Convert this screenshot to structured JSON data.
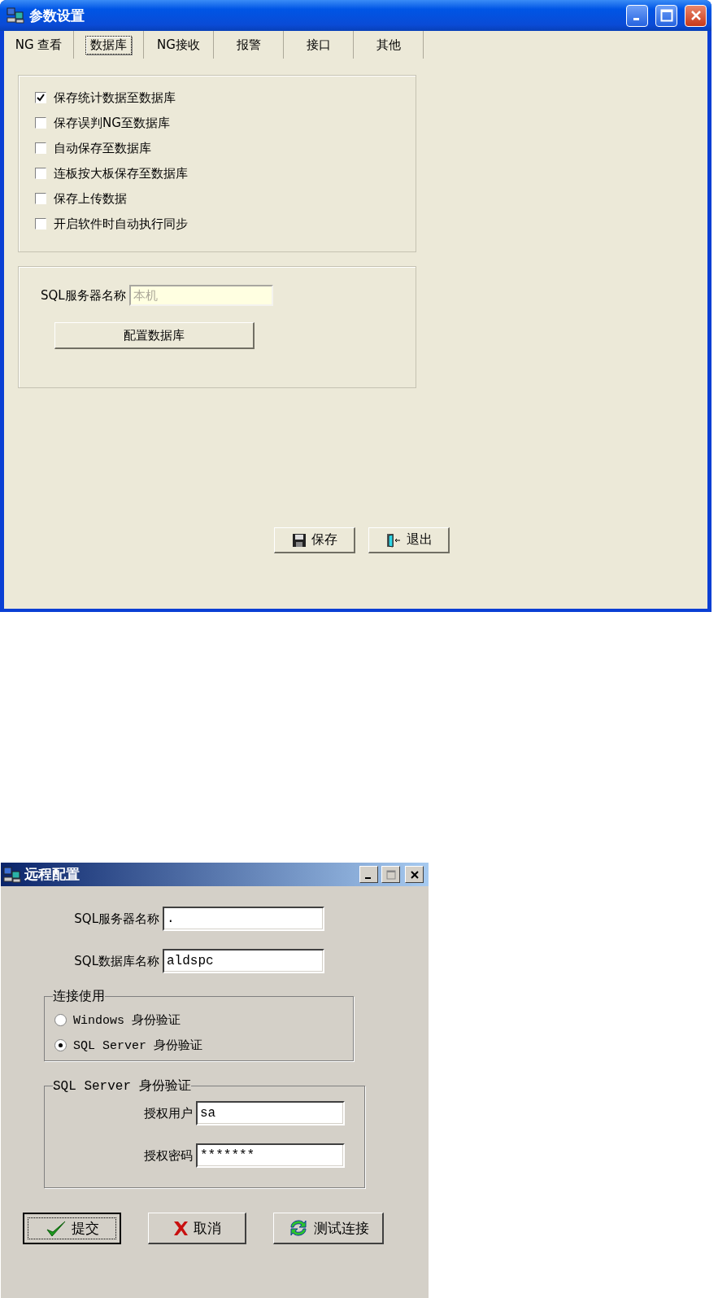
{
  "main_window": {
    "title": "参数设置",
    "tabs": [
      {
        "label": "NG 查看",
        "selected": false
      },
      {
        "label": "数据库",
        "selected": true
      },
      {
        "label": "NG接收",
        "selected": false
      },
      {
        "label": "报警",
        "selected": false
      },
      {
        "label": "接口",
        "selected": false
      },
      {
        "label": "其他",
        "selected": false
      }
    ],
    "options": [
      {
        "label": "保存统计数据至数据库",
        "checked": true
      },
      {
        "label": "保存误判NG至数据库",
        "checked": false
      },
      {
        "label": "自动保存至数据库",
        "checked": false
      },
      {
        "label": "连板按大板保存至数据库",
        "checked": false
      },
      {
        "label": "保存上传数据",
        "checked": false
      },
      {
        "label": "开启软件时自动执行同步",
        "checked": false
      }
    ],
    "server_name": {
      "label": "SQL服务器名称",
      "placeholder": "本机"
    },
    "configure_button": "配置数据库",
    "buttons": [
      {
        "kind": "save",
        "label": "保存"
      },
      {
        "kind": "exit",
        "label": "退出"
      }
    ]
  },
  "remote_window": {
    "title": "远程配置",
    "fields": [
      {
        "label": "SQL服务器名称",
        "value": "."
      },
      {
        "label": "SQL数据库名称",
        "value": "aldspc"
      }
    ],
    "connect_group": {
      "title": "连接使用",
      "options": [
        {
          "label": "Windows 身份验证",
          "selected": false
        },
        {
          "label": "SQL Server 身份验证",
          "selected": true
        }
      ]
    },
    "auth_group": {
      "title": "SQL Server 身份验证",
      "fields": [
        {
          "label": "授权用户",
          "value": "sa"
        },
        {
          "label": "授权密码",
          "value": "*******"
        }
      ]
    },
    "buttons": [
      {
        "kind": "submit",
        "label": "提交",
        "selected": true
      },
      {
        "kind": "cancel",
        "label": "取消",
        "selected": false
      },
      {
        "kind": "test",
        "label": "测试连接",
        "selected": false
      }
    ]
  }
}
